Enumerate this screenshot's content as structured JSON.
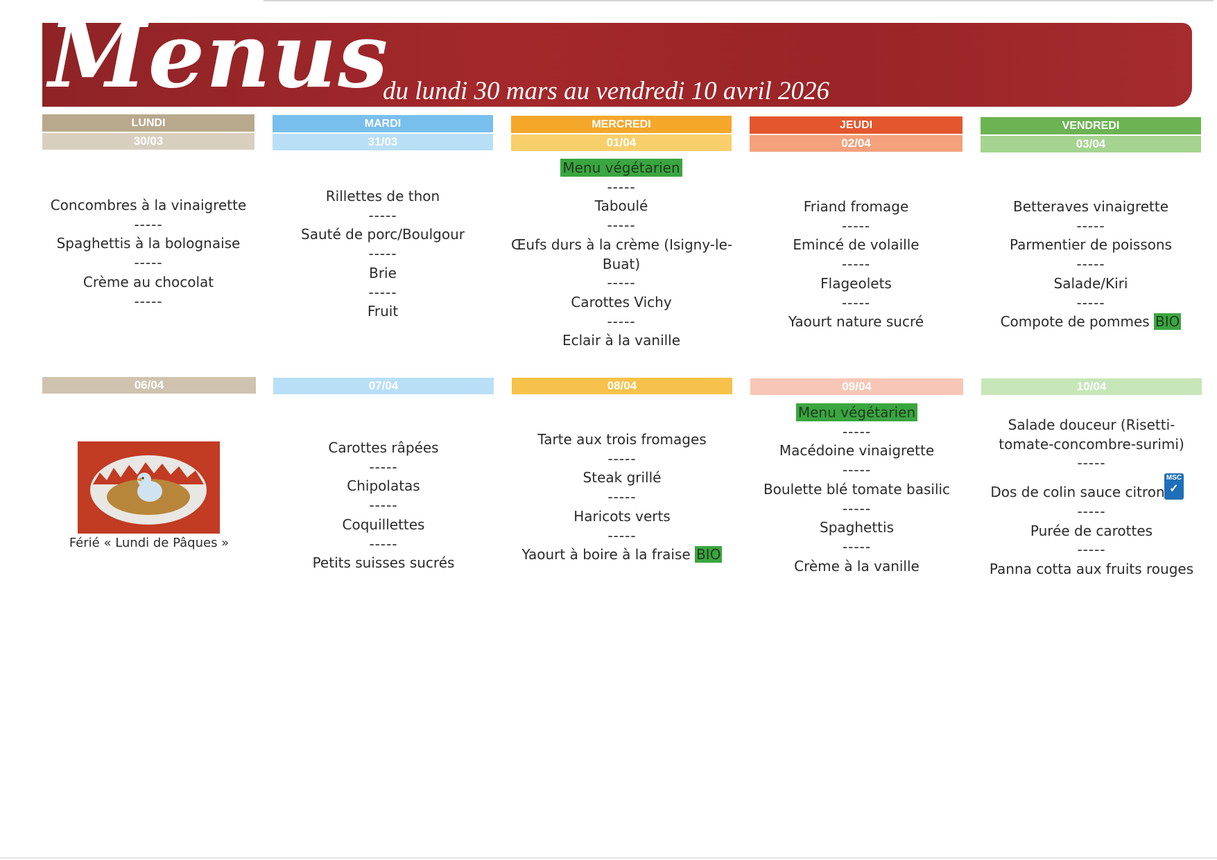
{
  "header": {
    "title": "Menus",
    "subtitle": "du lundi  30 mars au vendredi 10 avril 2026"
  },
  "colors": {
    "banner": "#9e2629",
    "lundi": "#b8a88c",
    "mardi": "#79bfee",
    "mercredi": "#f5a72a",
    "jeudi": "#e3562e",
    "vendredi": "#6cb354",
    "vegetarian_highlight": "#3aa640",
    "msc_badge": "#1f6fb8"
  },
  "week1": {
    "days": [
      {
        "name": "LUNDI",
        "date": "30/03",
        "items": [
          "Concombres à la vinaigrette",
          "-----",
          "Spaghettis à la bolognaise",
          "-----",
          "Crème au chocolat",
          "-----"
        ]
      },
      {
        "name": "MARDI",
        "date": "31/03",
        "items": [
          "Rillettes de thon",
          "-----",
          "Sauté de porc/Boulgour",
          "-----",
          "Brie",
          "-----",
          "Fruit"
        ]
      },
      {
        "name": "MERCREDI",
        "date": "01/04",
        "tag": "Menu végétarien",
        "items": [
          "-----",
          "Taboulé",
          "-----",
          "Œufs durs à la crème (Isigny-le-",
          "Buat)",
          "-----",
          "Carottes Vichy",
          "-----",
          "Eclair à la vanille"
        ]
      },
      {
        "name": "JEUDI",
        "date": "02/04",
        "items": [
          "Friand fromage",
          "-----",
          "Emincé de volaille",
          "-----",
          "Flageolets",
          "-----",
          "Yaourt nature sucré"
        ]
      },
      {
        "name": "VENDREDI",
        "date": "03/04",
        "items": [
          "Betteraves vinaigrette",
          "-----",
          "Parmentier de poissons",
          "-----",
          "Salade/Kiri",
          "-----"
        ],
        "last_item": "Compote de pommes ",
        "last_badge": "BIO"
      }
    ]
  },
  "week2": {
    "days": [
      {
        "date": "06/04",
        "holiday": "Férié « Lundi de Pâques »",
        "image": "easter-egg-chick"
      },
      {
        "date": "07/04",
        "items": [
          "Carottes râpées",
          "-----",
          "Chipolatas",
          "-----",
          "Coquillettes",
          "-----",
          "Petits suisses sucrés"
        ]
      },
      {
        "date": "08/04",
        "items": [
          "Tarte aux trois fromages",
          "-----",
          "Steak grillé",
          "-----",
          "Haricots verts",
          "-----"
        ],
        "last_item": "Yaourt à boire à la fraise ",
        "last_badge": "BIO"
      },
      {
        "date": "09/04",
        "tag": "Menu végétarien",
        "items": [
          "-----",
          "Macédoine vinaigrette",
          "-----",
          "Boulette blé tomate basilic",
          "-----",
          "Spaghettis",
          "-----",
          "Crème à la vanille"
        ]
      },
      {
        "date": "10/04",
        "items_before": [
          "Salade douceur (Risetti-",
          "tomate-concombre-surimi)",
          "-----"
        ],
        "msc_item": "Dos de colin sauce citron",
        "msc_label": "MSC",
        "items_after": [
          "-----",
          "Purée de carottes",
          "-----",
          "Panna cotta aux fruits rouges"
        ]
      }
    ]
  }
}
